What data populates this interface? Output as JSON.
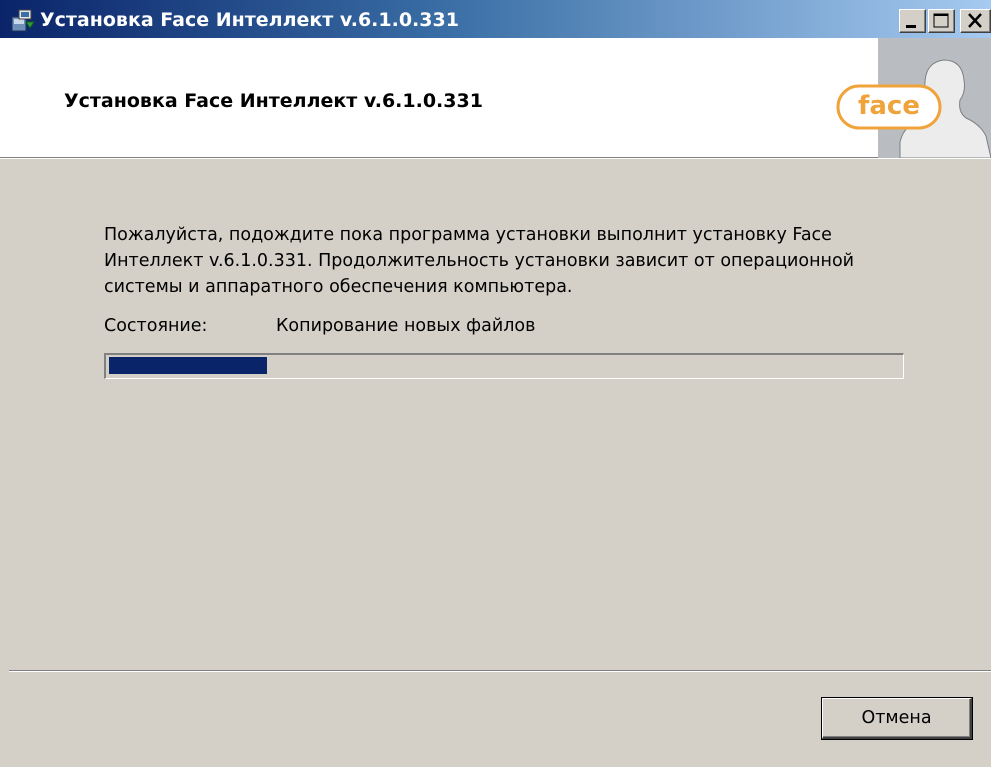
{
  "window": {
    "title": "Установка Face Интеллект v.6.1.0.331",
    "app_icon": "installer-icon",
    "controls": [
      "minimize-icon",
      "maximize-icon",
      "close-icon"
    ]
  },
  "header": {
    "title": "Установка Face Интеллект v.6.1.0.331",
    "logo_text": "face",
    "logo_color": "#f0a33a"
  },
  "main": {
    "description": "Пожалуйста, подождите пока программа установки выполнит установку Face Интеллект v.6.1.0.331. Продолжительность установки зависит от операционной системы и аппаратного обеспечения компьютера.",
    "status_label": "Состояние:",
    "status_value": "Копирование новых файлов",
    "progress_fraction": 0.2,
    "progress_color": "#0a246a"
  },
  "footer": {
    "cancel_label": "Отмена"
  },
  "colors": {
    "dialog_bg": "#d4d0c8",
    "titlebar_start": "#0a246a",
    "titlebar_end": "#a6caf0"
  }
}
